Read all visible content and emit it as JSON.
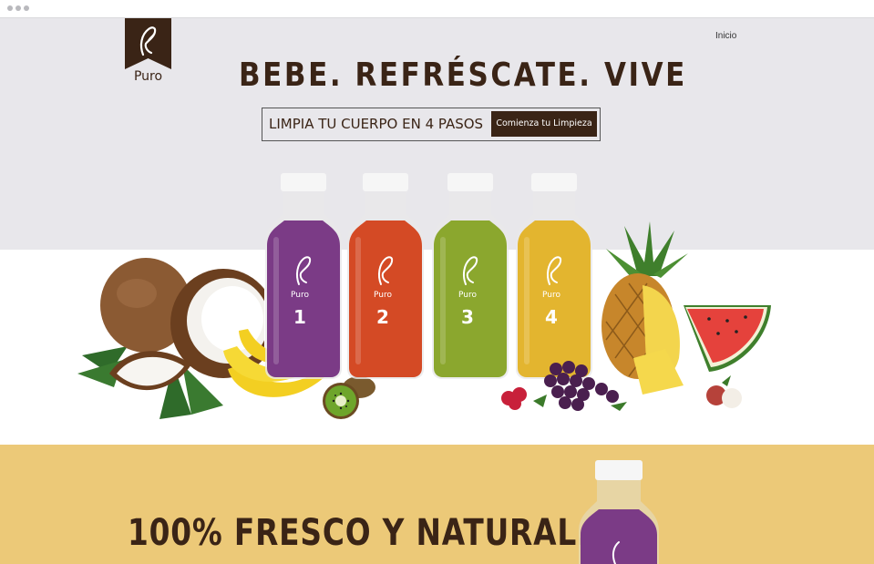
{
  "browser": {
    "window_dots": [
      "close",
      "minimize",
      "maximize"
    ]
  },
  "brand": {
    "name": "Puro",
    "logo_icon": "leaf-icon",
    "color": "#3a2416"
  },
  "nav": {
    "inicio": "Inicio"
  },
  "hero": {
    "headline": "BEBE. REFRÉSCATE. VIVE",
    "cta_text": "LIMPIA TU CUERPO EN 4 PASOS",
    "cta_button": "Comienza tu Limpieza",
    "background_top": "#e8e7eb"
  },
  "bottles": [
    {
      "label": "Puro",
      "number": "1",
      "color": "#7b3b86"
    },
    {
      "label": "Puro",
      "number": "2",
      "color": "#d44a25"
    },
    {
      "label": "Puro",
      "number": "3",
      "color": "#8ba72e"
    },
    {
      "label": "Puro",
      "number": "4",
      "color": "#e3b52f"
    }
  ],
  "section2": {
    "headline": "100% FRESCO Y NATURAL.",
    "background": "#ecc978"
  }
}
